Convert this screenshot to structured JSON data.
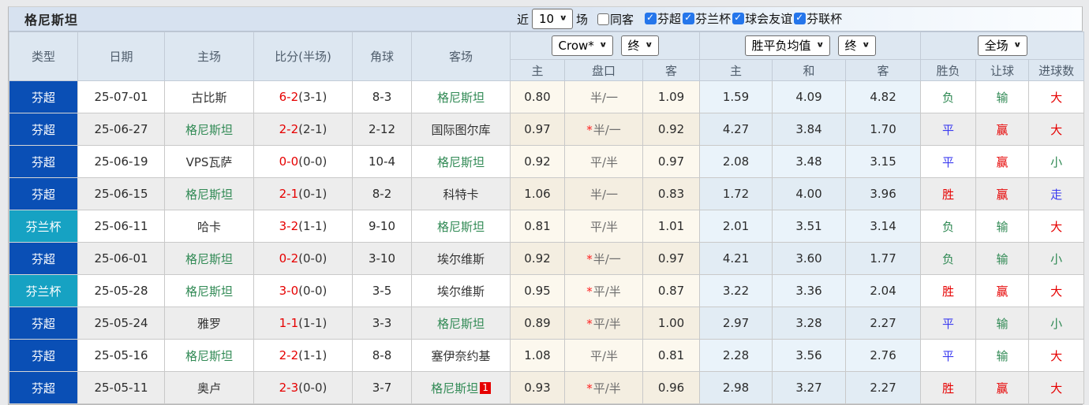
{
  "title": "格尼斯坦",
  "controls": {
    "recent_label": "近",
    "recent_value": "10",
    "games_label": "场",
    "same_away": {
      "label": "同客",
      "checked": false
    },
    "league_filters": [
      {
        "label": "芬超",
        "checked": true
      },
      {
        "label": "芬兰杯",
        "checked": true
      },
      {
        "label": "球会友谊",
        "checked": true
      },
      {
        "label": "芬联杯",
        "checked": true
      }
    ]
  },
  "header": {
    "static_cols": [
      "类型",
      "日期",
      "主场",
      "比分(半场)",
      "角球",
      "客场"
    ],
    "odds_company_select": "Crow*",
    "odds_time_select": "终",
    "avg_select": "胜平负均值",
    "avg_time_select": "终",
    "scope_select": "全场",
    "odds_sub": [
      "主",
      "盘口",
      "客"
    ],
    "avg_sub": [
      "主",
      "和",
      "客"
    ],
    "result_cols": [
      "胜负",
      "让球",
      "进球数"
    ]
  },
  "accent_colors": {
    "league_super_bg": "#0a4fb5",
    "league_cup_bg": "#16a2c3",
    "team_highlight": "#318a55",
    "win_red": "#e60000",
    "draw_blue": "#3b3bf0",
    "lose_green": "#318a55"
  },
  "rows": [
    {
      "type": "芬超",
      "type_style": "super",
      "date": "25-07-01",
      "home": "古比斯",
      "home_color": "black",
      "score": "6-2",
      "half": "(3-1)",
      "corners": "8-3",
      "away": "格尼斯坦",
      "away_color": "green",
      "away_badge": "",
      "odds_home": "0.80",
      "star": "",
      "handicap": "半/一",
      "odds_away": "1.09",
      "avg_home": "1.59",
      "avg_draw": "4.09",
      "avg_away": "4.82",
      "outcome": "负",
      "outcome_color": "green",
      "hcp_result": "输",
      "hcp_color": "green",
      "goals": "大",
      "goals_color": "red"
    },
    {
      "type": "芬超",
      "type_style": "super",
      "date": "25-06-27",
      "home": "格尼斯坦",
      "home_color": "green",
      "score": "2-2",
      "half": "(2-1)",
      "corners": "2-12",
      "away": "国际图尔库",
      "away_color": "black",
      "away_badge": "",
      "odds_home": "0.97",
      "star": "*",
      "handicap": "半/一",
      "odds_away": "0.92",
      "avg_home": "4.27",
      "avg_draw": "3.84",
      "avg_away": "1.70",
      "outcome": "平",
      "outcome_color": "blue",
      "hcp_result": "赢",
      "hcp_color": "red",
      "goals": "大",
      "goals_color": "red"
    },
    {
      "type": "芬超",
      "type_style": "super",
      "date": "25-06-19",
      "home": "VPS瓦萨",
      "home_color": "black",
      "score": "0-0",
      "half": "(0-0)",
      "corners": "10-4",
      "away": "格尼斯坦",
      "away_color": "green",
      "away_badge": "",
      "odds_home": "0.92",
      "star": "",
      "handicap": "平/半",
      "odds_away": "0.97",
      "avg_home": "2.08",
      "avg_draw": "3.48",
      "avg_away": "3.15",
      "outcome": "平",
      "outcome_color": "blue",
      "hcp_result": "赢",
      "hcp_color": "red",
      "goals": "小",
      "goals_color": "green"
    },
    {
      "type": "芬超",
      "type_style": "super",
      "date": "25-06-15",
      "home": "格尼斯坦",
      "home_color": "green",
      "score": "2-1",
      "half": "(0-1)",
      "corners": "8-2",
      "away": "科特卡",
      "away_color": "black",
      "away_badge": "",
      "odds_home": "1.06",
      "star": "",
      "handicap": "半/一",
      "odds_away": "0.83",
      "avg_home": "1.72",
      "avg_draw": "4.00",
      "avg_away": "3.96",
      "outcome": "胜",
      "outcome_color": "red",
      "hcp_result": "赢",
      "hcp_color": "red",
      "goals": "走",
      "goals_color": "blue"
    },
    {
      "type": "芬兰杯",
      "type_style": "cup",
      "date": "25-06-11",
      "home": "哈卡",
      "home_color": "black",
      "score": "3-2",
      "half": "(1-1)",
      "corners": "9-10",
      "away": "格尼斯坦",
      "away_color": "green",
      "away_badge": "",
      "odds_home": "0.81",
      "star": "",
      "handicap": "平/半",
      "odds_away": "1.01",
      "avg_home": "2.01",
      "avg_draw": "3.51",
      "avg_away": "3.14",
      "outcome": "负",
      "outcome_color": "green",
      "hcp_result": "输",
      "hcp_color": "green",
      "goals": "大",
      "goals_color": "red"
    },
    {
      "type": "芬超",
      "type_style": "super",
      "date": "25-06-01",
      "home": "格尼斯坦",
      "home_color": "green",
      "score": "0-2",
      "half": "(0-0)",
      "corners": "3-10",
      "away": "埃尔维斯",
      "away_color": "black",
      "away_badge": "",
      "odds_home": "0.92",
      "star": "*",
      "handicap": "半/一",
      "odds_away": "0.97",
      "avg_home": "4.21",
      "avg_draw": "3.60",
      "avg_away": "1.77",
      "outcome": "负",
      "outcome_color": "green",
      "hcp_result": "输",
      "hcp_color": "green",
      "goals": "小",
      "goals_color": "green"
    },
    {
      "type": "芬兰杯",
      "type_style": "cup",
      "date": "25-05-28",
      "home": "格尼斯坦",
      "home_color": "green",
      "score": "3-0",
      "half": "(0-0)",
      "corners": "3-5",
      "away": "埃尔维斯",
      "away_color": "black",
      "away_badge": "",
      "odds_home": "0.95",
      "star": "*",
      "handicap": "平/半",
      "odds_away": "0.87",
      "avg_home": "3.22",
      "avg_draw": "3.36",
      "avg_away": "2.04",
      "outcome": "胜",
      "outcome_color": "red",
      "hcp_result": "赢",
      "hcp_color": "red",
      "goals": "大",
      "goals_color": "red"
    },
    {
      "type": "芬超",
      "type_style": "super",
      "date": "25-05-24",
      "home": "雅罗",
      "home_color": "black",
      "score": "1-1",
      "half": "(1-1)",
      "corners": "3-3",
      "away": "格尼斯坦",
      "away_color": "green",
      "away_badge": "",
      "odds_home": "0.89",
      "star": "*",
      "handicap": "平/半",
      "odds_away": "1.00",
      "avg_home": "2.97",
      "avg_draw": "3.28",
      "avg_away": "2.27",
      "outcome": "平",
      "outcome_color": "blue",
      "hcp_result": "输",
      "hcp_color": "green",
      "goals": "小",
      "goals_color": "green"
    },
    {
      "type": "芬超",
      "type_style": "super",
      "date": "25-05-16",
      "home": "格尼斯坦",
      "home_color": "green",
      "score": "2-2",
      "half": "(1-1)",
      "corners": "8-8",
      "away": "塞伊奈约基",
      "away_color": "black",
      "away_badge": "",
      "odds_home": "1.08",
      "star": "",
      "handicap": "平/半",
      "odds_away": "0.81",
      "avg_home": "2.28",
      "avg_draw": "3.56",
      "avg_away": "2.76",
      "outcome": "平",
      "outcome_color": "blue",
      "hcp_result": "输",
      "hcp_color": "green",
      "goals": "大",
      "goals_color": "red"
    },
    {
      "type": "芬超",
      "type_style": "super",
      "date": "25-05-11",
      "home": "奥卢",
      "home_color": "black",
      "score": "2-3",
      "half": "(0-0)",
      "corners": "3-7",
      "away": "格尼斯坦",
      "away_color": "green",
      "away_badge": "1",
      "odds_home": "0.93",
      "star": "*",
      "handicap": "平/半",
      "odds_away": "0.96",
      "avg_home": "2.98",
      "avg_draw": "3.27",
      "avg_away": "2.27",
      "outcome": "胜",
      "outcome_color": "red",
      "hcp_result": "赢",
      "hcp_color": "red",
      "goals": "大",
      "goals_color": "red"
    }
  ]
}
